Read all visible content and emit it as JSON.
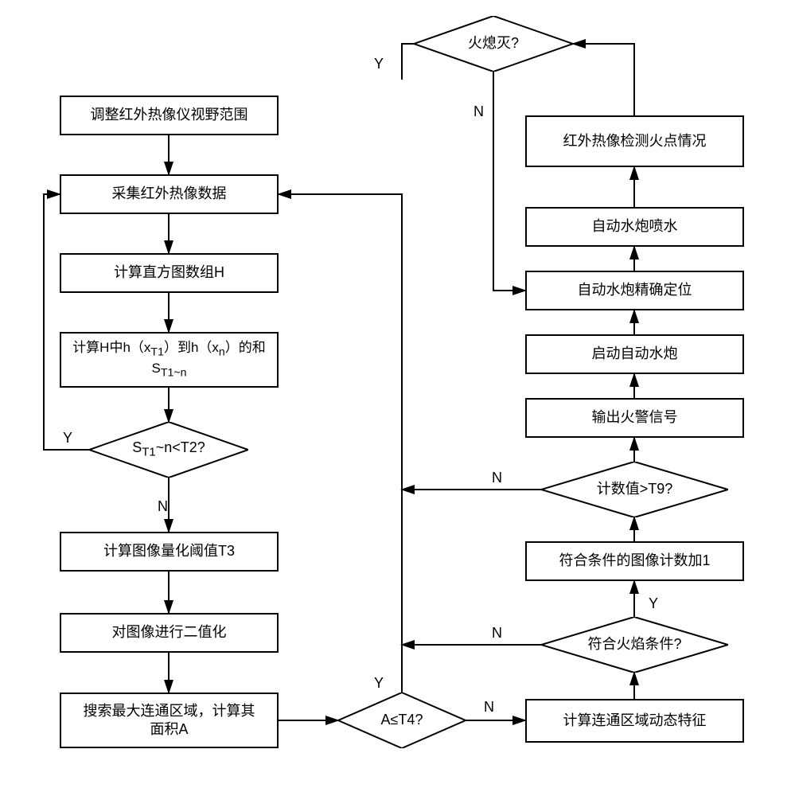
{
  "flowchart": {
    "nodes": {
      "left": {
        "n1": "调整红外热像仪视野范围",
        "n2": "采集红外热像数据",
        "n3": "计算直方图数组H",
        "n4_line1": "计算H中h（x",
        "n4_line1_sub": "T1",
        "n4_line1_mid": "）到h（x",
        "n4_line1_sub2": "n",
        "n4_line1_end": "）的和",
        "n4_line2_a": "S",
        "n4_line2_sub": "T1~n",
        "d1_a": "S",
        "d1_sub": "T1",
        "d1_rest": "~n<T2?",
        "n5": "计算图像量化阈值T3",
        "n6": "对图像进行二值化",
        "n7_line1": "搜索最大连通区域，计算其",
        "n7_line2": "面积A"
      },
      "center": {
        "d2": "A≤T4?",
        "d_top": "火熄灭?"
      },
      "right": {
        "r1": "计算连通区域动态特征",
        "d3": "符合火焰条件?",
        "r2": "符合条件的图像计数加1",
        "d4": "计数值>T9?",
        "r3": "输出火警信号",
        "r4": "启动自动水炮",
        "r5": "自动水炮精确定位",
        "r6": "自动水炮喷水",
        "r7": "红外热像检测火点情况"
      }
    },
    "labels": {
      "Y": "Y",
      "N": "N"
    }
  }
}
